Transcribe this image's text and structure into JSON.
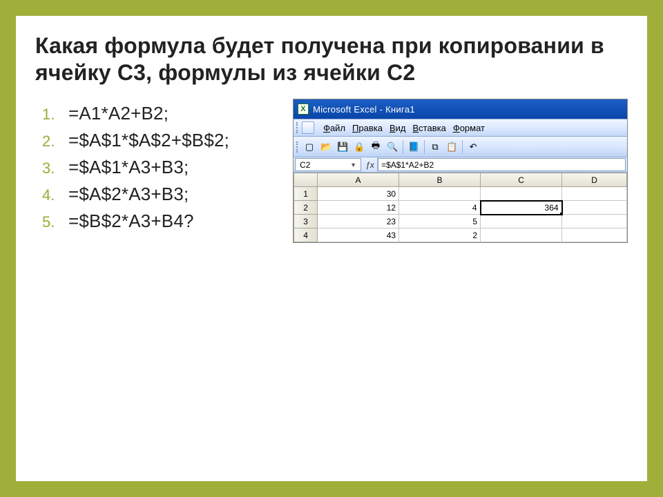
{
  "heading": "Какая формула будет получена при копировании в ячейку С3, формулы из ячейки С2",
  "answers": [
    {
      "num": "1.",
      "text": "=A1*A2+B2;"
    },
    {
      "num": "2.",
      "text": "=$A$1*$A$2+$B$2;"
    },
    {
      "num": "3.",
      "text": "=$A$1*A3+B3;"
    },
    {
      "num": "4.",
      "text": "=$A$2*A3+B3;"
    },
    {
      "num": "5.",
      "text": "=$B$2*A3+B4?"
    }
  ],
  "excel": {
    "title": "Microsoft Excel - Книга1",
    "menu": [
      "Файл",
      "Правка",
      "Вид",
      "Вставка",
      "Формат"
    ],
    "toolbar_icons": [
      "new",
      "open",
      "save",
      "perm",
      "print",
      "preview",
      "sep",
      "research",
      "sep",
      "copy",
      "paste",
      "sep",
      "undo"
    ],
    "namebox": "C2",
    "formula": "=$A$1*A2+B2",
    "columns": [
      "A",
      "B",
      "C",
      "D"
    ],
    "rows": [
      {
        "n": "1",
        "cells": [
          "30",
          "",
          "",
          ""
        ]
      },
      {
        "n": "2",
        "cells": [
          "12",
          "4",
          "364",
          ""
        ]
      },
      {
        "n": "3",
        "cells": [
          "23",
          "5",
          "",
          ""
        ]
      },
      {
        "n": "4",
        "cells": [
          "43",
          "2",
          "",
          ""
        ]
      }
    ],
    "active": {
      "row": 1,
      "col": 2
    }
  }
}
